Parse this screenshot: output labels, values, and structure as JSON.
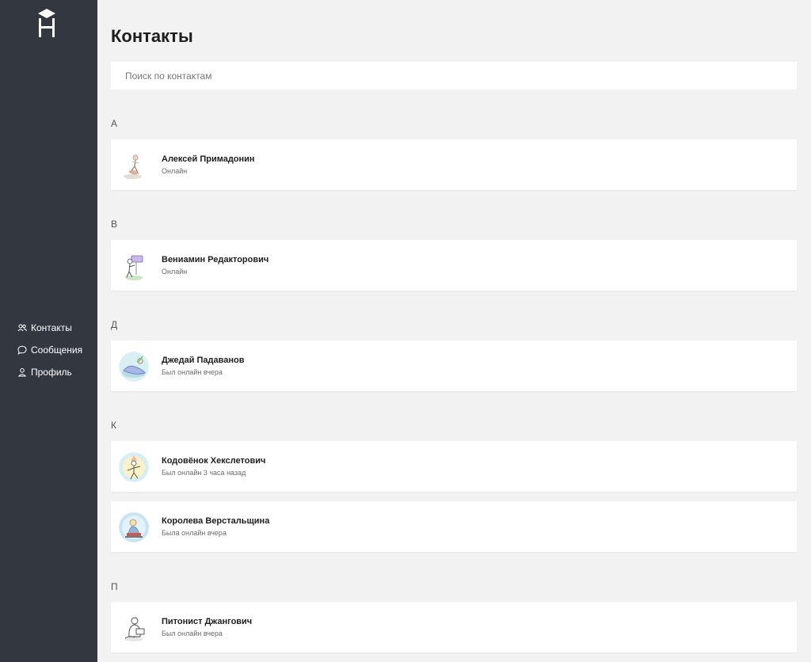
{
  "sidebar": {
    "logo_icon": "hexlet-logo",
    "nav": [
      {
        "label": "Контакты",
        "icon": "users-icon"
      },
      {
        "label": "Сообщения",
        "icon": "chat-bubble-icon"
      },
      {
        "label": "Профиль",
        "icon": "user-icon"
      }
    ]
  },
  "main": {
    "title": "Контакты",
    "search": {
      "placeholder": "Поиск по контактам",
      "value": ""
    },
    "groups": [
      {
        "letter": "А",
        "contacts": [
          {
            "name": "Алексей Примадонин",
            "status": "Онлайн",
            "avatar": "avatar-dancer"
          }
        ]
      },
      {
        "letter": "В",
        "contacts": [
          {
            "name": "Вениамин Редакторович",
            "status": "Онлайн",
            "avatar": "avatar-editor"
          }
        ]
      },
      {
        "letter": "Д",
        "contacts": [
          {
            "name": "Джедай Падаванов",
            "status": "Был онлайн вчера",
            "avatar": "avatar-jedi"
          }
        ]
      },
      {
        "letter": "К",
        "contacts": [
          {
            "name": "Кодовёнок Хекслетович",
            "status": "Был онлайн 3 часа назад",
            "avatar": "avatar-kid"
          },
          {
            "name": "Королева Верстальщина",
            "status": "Была онлайн вчера",
            "avatar": "avatar-queen"
          }
        ]
      },
      {
        "letter": "П",
        "contacts": [
          {
            "name": "Питонист Джангович",
            "status": "Был онлайн вчера",
            "avatar": "avatar-pythonist"
          }
        ]
      }
    ]
  },
  "colors": {
    "sidebar_bg": "#333740",
    "page_bg": "#f2f2f2",
    "card_bg": "#ffffff"
  }
}
